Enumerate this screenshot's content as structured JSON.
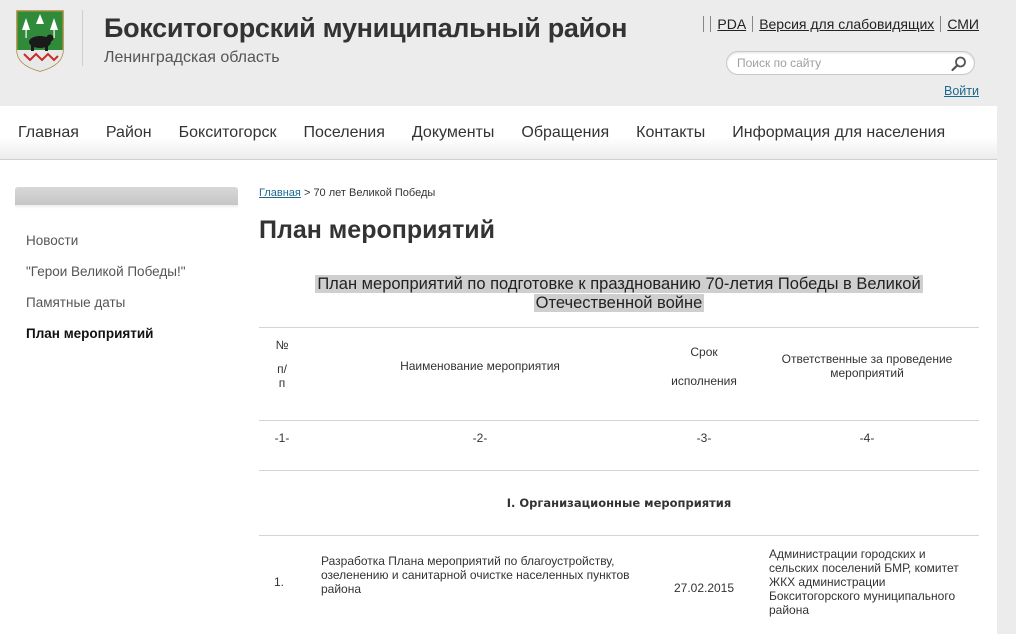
{
  "header": {
    "title": "Бокситогорский муниципальный район",
    "subtitle": "Ленинградская область",
    "links": [
      "PDA",
      "Версия для слабовидящих",
      "СМИ"
    ],
    "search_placeholder": "Поиск по сайту",
    "login": "Войти"
  },
  "nav": {
    "items": [
      "Главная",
      "Район",
      "Бокситогорск",
      "Поселения",
      "Документы",
      "Обращения",
      "Контакты",
      "Информация для населения"
    ]
  },
  "sidebar": {
    "items": [
      "Новости",
      "\"Герои Великой Победы!\"",
      "Памятные даты",
      "План мероприятий"
    ],
    "active_index": 3
  },
  "breadcrumb": {
    "home": "Главная",
    "separator": ">",
    "current": "70 лет Великой Победы"
  },
  "page": {
    "title": "План мероприятий",
    "doc_heading_line1": "План мероприятий по подготовке к празднованию 70-летия Победы в Великой",
    "doc_heading_line2": "Отечественной войне"
  },
  "table": {
    "header": {
      "num_l1": "№",
      "num_l2": "п/",
      "num_l3": "п",
      "name": "Наименование мероприятия",
      "term_l1": "Срок",
      "term_l2": "исполнения",
      "resp": "Ответственные за проведение мероприятий"
    },
    "index_row": [
      "-1-",
      "-2-",
      "-3-",
      "-4-"
    ],
    "section_title": "I. Организационные мероприятия",
    "rows": [
      {
        "num": "1.",
        "name": "Разработка Плана мероприятий по благоустройству, озеленению и санитарной очистке населенных пунктов района",
        "term": "27.02.2015",
        "resp": "Администрации городских и сельских поселений БМР, комитет ЖКХ администрации Бокситогорского муниципального района"
      }
    ]
  },
  "colors": {
    "link": "#1b6a8c",
    "header_bg": "#ececec",
    "highlight": "#cfcfcf"
  }
}
